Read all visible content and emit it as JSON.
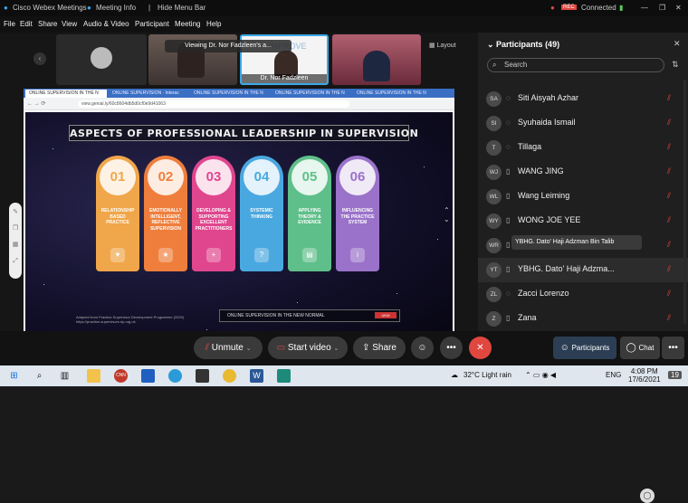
{
  "titlebar": {
    "app_title": "Cisco Webex Meetings",
    "meeting_info": "Meeting Info",
    "hide_menu": "Hide Menu Bar",
    "rec_badge": "REC",
    "connected": "Connected"
  },
  "menu": [
    "File",
    "Edit",
    "Share",
    "View",
    "Audio & Video",
    "Participant",
    "Meeting",
    "Help"
  ],
  "video": {
    "tile_label": "Dr. Nor Fadzleen",
    "layout_label": "Layout",
    "viewing_banner": "Viewing Dr. Nor Fadzleen's a..."
  },
  "browser": {
    "tabs": [
      "ONLINE SUPERVISION IN THE N",
      "ONLINE SUPERVISION · Interac",
      "ONLINE SUPERVISION IN THE N",
      "ONLINE SUPERVISION IN THE N",
      "ONLINE SUPERVISION IN THE N"
    ],
    "url": "view.genial.ly/60c8604db5d0cf0e9d41063"
  },
  "slide": {
    "title": "ASPECTS OF PROFESSIONAL LEADERSHIP IN SUPERVISION",
    "cards": [
      {
        "num": "01",
        "text": "RELATIONSHIP BASED PRACTICE",
        "color": "#f0a64a",
        "icon": "heart-icon",
        "glyph": "♥"
      },
      {
        "num": "02",
        "text": "EMOTIONALLY INTELLIGENT, REFLECTIVE SUPERVISION",
        "color": "#ef7e3c",
        "icon": "star-icon",
        "glyph": "★"
      },
      {
        "num": "03",
        "text": "DEVELOPING & SUPPORTING EXCELLENT PRACTITIONERS",
        "color": "#e0468e",
        "icon": "plus-icon",
        "glyph": "+"
      },
      {
        "num": "04",
        "text": "SYSTEMIC THINKING",
        "color": "#4aa8e0",
        "icon": "question-icon",
        "glyph": "?"
      },
      {
        "num": "05",
        "text": "APPLYING THEORY & EVIDENCE",
        "color": "#5fbf8a",
        "icon": "book-icon",
        "glyph": "▤"
      },
      {
        "num": "06",
        "text": "INFLUENCING THE PRACTICE SYSTEM",
        "color": "#9a72c9",
        "icon": "info-icon",
        "glyph": "i"
      }
    ],
    "footer": "ONLINE SUPERVISION IN THE NEW NORMAL",
    "footer_logo": "UKM",
    "credit": "Adapted from Practice Supervisor Development Programme (2020) https://practice-supervisors.rip.org.uk"
  },
  "participants": {
    "title": "Participants (49)",
    "search_placeholder": "Search",
    "list": [
      {
        "initials": "SA",
        "name": "Siti Aisyah Azhar",
        "device": "headset"
      },
      {
        "initials": "SI",
        "name": "Syuhaida Ismail",
        "device": "headset"
      },
      {
        "initials": "T",
        "name": "Tillaga",
        "device": "headset"
      },
      {
        "initials": "WJ",
        "name": "WANG JING",
        "device": "phone"
      },
      {
        "initials": "WL",
        "name": "Wang Leiming",
        "device": "phone"
      },
      {
        "initials": "WY",
        "name": "WONG JOE YEE",
        "device": "phone"
      },
      {
        "initials": "WR",
        "name": "",
        "device": "phone"
      },
      {
        "initials": "YT",
        "name": "YBHG. Dato' Haji Adzma...",
        "device": "phone"
      },
      {
        "initials": "ZL",
        "name": "Zacci Lorenzo",
        "device": "headset"
      },
      {
        "initials": "Z",
        "name": "Zana",
        "device": "phone"
      }
    ],
    "tooltip": "YBHG. Dato' Haji Adzman Bin Talib"
  },
  "controls": {
    "unmute": "Unmute",
    "start_video": "Start video",
    "share": "Share",
    "participants": "Participants",
    "chat": "Chat"
  },
  "taskbar": {
    "weather": "32°C  Light rain",
    "lang": "ENG",
    "time": "4:08 PM",
    "date": "17/6/2021",
    "notif": "19"
  }
}
